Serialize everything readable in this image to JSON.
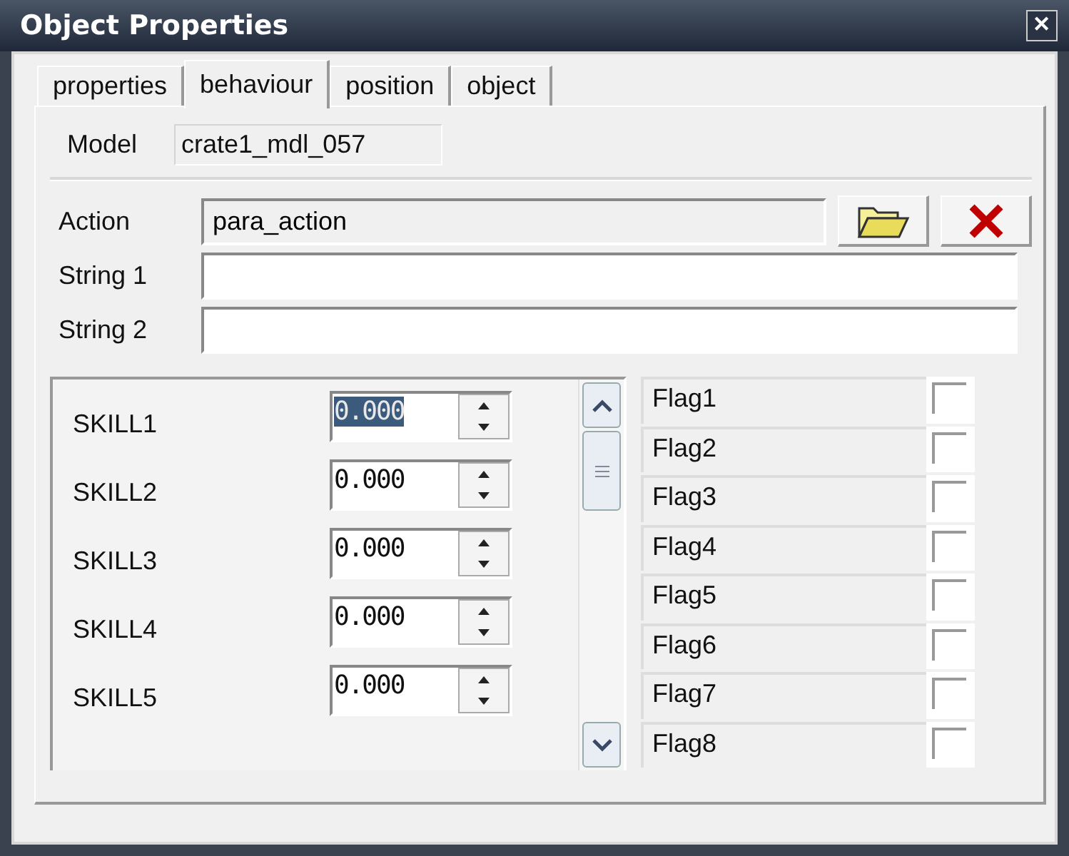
{
  "window": {
    "title": "Object Properties",
    "close": "✕"
  },
  "tabs": [
    {
      "label": "properties",
      "selected": false
    },
    {
      "label": "behaviour",
      "selected": true
    },
    {
      "label": "position",
      "selected": false
    },
    {
      "label": "object",
      "selected": false
    }
  ],
  "model": {
    "label": "Model",
    "value": "crate1_mdl_057"
  },
  "action": {
    "label": "Action",
    "value": "para_action"
  },
  "strings": [
    {
      "label": "String 1"
    },
    {
      "label": "String 2"
    }
  ],
  "skills": [
    {
      "label": "SKILL1",
      "value": "0.000",
      "selected": true
    },
    {
      "label": "SKILL2",
      "value": "0.000",
      "selected": false
    },
    {
      "label": "SKILL3",
      "value": "0.000",
      "selected": false
    },
    {
      "label": "SKILL4",
      "value": "0.000",
      "selected": false
    },
    {
      "label": "SKILL5",
      "value": "0.000",
      "selected": false
    }
  ],
  "flags": [
    {
      "label": "Flag1",
      "checked": false
    },
    {
      "label": "Flag2",
      "checked": false
    },
    {
      "label": "Flag3",
      "checked": false
    },
    {
      "label": "Flag4",
      "checked": false
    },
    {
      "label": "Flag5",
      "checked": false
    },
    {
      "label": "Flag6",
      "checked": false
    },
    {
      "label": "Flag7",
      "checked": false
    },
    {
      "label": "Flag8",
      "checked": false
    }
  ]
}
